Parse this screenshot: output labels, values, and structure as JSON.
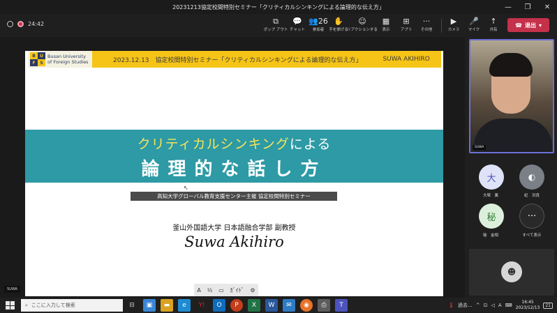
{
  "window": {
    "title": "20231213協定校間特別セミナー「クリティカルシンキングによる論理的な伝え方」",
    "controls": [
      "—",
      "❐",
      "✕"
    ]
  },
  "meeting": {
    "elapsed": "24:42"
  },
  "toolbar": {
    "buttons": [
      {
        "icon": "⧉",
        "label": "ポップ アウト"
      },
      {
        "icon": "💬",
        "label": "チャット"
      },
      {
        "icon": "👥26",
        "label": "参加者"
      },
      {
        "icon": "✋",
        "label": "手を挙げる"
      },
      {
        "icon": "☺",
        "label": "リアクションする"
      },
      {
        "icon": "▦",
        "label": "表示"
      },
      {
        "icon": "⊞",
        "label": "アプリ"
      },
      {
        "icon": "···",
        "label": "その他"
      },
      {
        "icon": "▶",
        "label": "カメラ"
      },
      {
        "icon": "🎤",
        "label": "マイク"
      },
      {
        "icon": "↑",
        "label": "共有"
      }
    ],
    "leave_label": "退出"
  },
  "slide": {
    "logo_letters": [
      "B",
      "U",
      "F",
      "S"
    ],
    "logo_name_1": "Busan University",
    "logo_name_2": "of Foreign Studies",
    "header_text": "2023.12.13　協定校間特別セミナー「クリティカルシンキングによる論理的な伝え方」",
    "header_name": "SUWA AKIHIRO",
    "title_line1_highlight": "クリティカルシンキング",
    "title_line1_rest": "による",
    "title_line2": "論理的な話し方",
    "subtitle": "高知大学グローバル教育支援センター主催 協定校間特別セミナー",
    "affiliation": "釜山外国語大学 日本語融合学部 副教授",
    "signature": "Suwa Akihiro"
  },
  "presenter_toolbar": [
    "A",
    "½",
    "▭",
    "ｶﾞｲﾄﾞ",
    "⚙"
  ],
  "presenter_name": "SUWA",
  "video": {
    "name": "SUWA"
  },
  "participants": [
    {
      "initial": "大",
      "name": "大塚　薫",
      "bg": "#dfe3f7",
      "fg": "#4f52b2"
    },
    {
      "initial": "",
      "name": "紀　洪良",
      "bg": "#7a7f88",
      "fg": "#ffffff"
    },
    {
      "initial": "秘",
      "name": "秘　金相",
      "bg": "#dcefdc",
      "fg": "#2e7d32"
    },
    {
      "initial": "···",
      "name": "すべて表示",
      "bg": "#292929",
      "fg": "#ffffff"
    }
  ],
  "taskbar": {
    "search_placeholder": "ここに入力して検索",
    "weather": "過去...",
    "ime": "A",
    "time": "16:45",
    "date": "2023/12/13",
    "notif": "21"
  },
  "colors": {
    "teal": "#2d9aa5",
    "yellow": "#f6c417",
    "leave_red": "#c4314b",
    "highlight": "#6b6fd6"
  }
}
